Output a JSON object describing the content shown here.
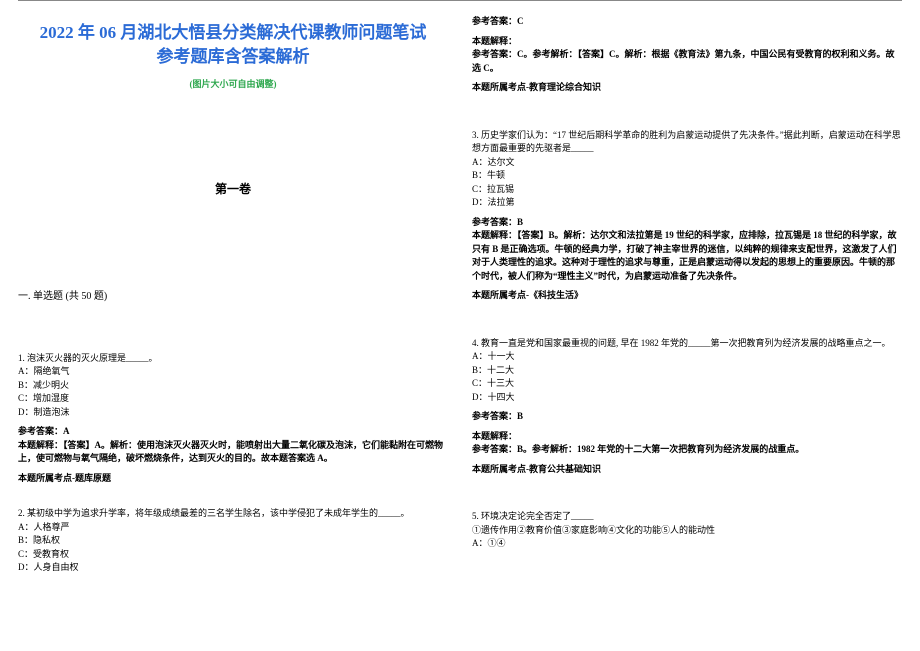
{
  "title_l1": "2022 年 06 月湖北大悟县分类解决代课教师问题笔试",
  "title_l2": "参考题库含答案解析",
  "subtitle": "(图片大小可自由调整)",
  "volume": "第一卷",
  "section1": "一. 单选题 (共 50 题)",
  "q1": {
    "stem": "1. 泡沫灭火器的灭火原理是_____。",
    "A": "A：隔绝氧气",
    "B": "B：减少明火",
    "C": "C：增加湿度",
    "D": "D：制造泡沫",
    "ans_label": "参考答案：A",
    "expl": "本题解释：【答案】A。解析：使用泡沫灭火器灭火时，能喷射出大量二氧化碳及泡沫，它们能黏附在可燃物上，使可燃物与氧气隔绝，破坏燃烧条件，达到灭火的目的。故本题答案选 A。",
    "point": "本题所属考点-题库原题"
  },
  "q2": {
    "stem": "2. 某初级中学为追求升学率，将年级成绩最差的三名学生除名，该中学侵犯了未成年学生的_____。",
    "A": "A：人格尊严",
    "B": "B：隐私权",
    "C": "C：受教育权",
    "D": "D：人身自由权",
    "ans_label": "参考答案：C",
    "expl_label": "本题解释：",
    "expl": "参考答案：C。参考解析：【答案】C。解析：根据《教育法》第九条，中国公民有受教育的权利和义务。故选 C。",
    "point": "本题所属考点-教育理论综合知识"
  },
  "q3": {
    "stem": "3. 历史学家们认为：“17 世纪后期科学革命的胜利为启蒙运动提供了先决条件。”据此判断，启蒙运动在科学思想方面最重要的先驱者是_____",
    "A": "A：达尔文",
    "B": "B：牛顿",
    "C": "C：拉瓦锡",
    "D": "D：法拉第",
    "ans_label": "参考答案：B",
    "expl": "本题解释：【答案】B。解析：达尔文和法拉第是 19 世纪的科学家，应排除，拉瓦锡是 18 世纪的科学家，故只有 B 是正确选项。牛顿的经典力学，打破了神主宰世界的迷信，以纯粹的规律来支配世界，这激发了人们对于人类理性的追求。这种对于理性的追求与尊重，正是启蒙运动得以发起的思想上的重要原因。牛顿的那个时代，被人们称为“理性主义”时代，为启蒙运动准备了先决条件。",
    "point": "本题所属考点-《科技生活》"
  },
  "q4": {
    "stem": "4. 教育一直是党和国家最重视的问题, 早在 1982 年党的_____第一次把教育列为经济发展的战略重点之一。",
    "A": "A：十一大",
    "B": "B：十二大",
    "C": "C：十三大",
    "D": "D：十四大",
    "ans_label": "参考答案：B",
    "expl_label": "本题解释：",
    "expl": "参考答案：B。参考解析：1982 年党的十二大第一次把教育列为经济发展的战重点。",
    "point": "本题所属考点-教育公共基础知识"
  },
  "q5": {
    "stem": "5. 环境决定论完全否定了_____",
    "sub": "①遗传作用②教育价值③家庭影响④文化的功能⑤人的能动性",
    "A": "A：①④"
  }
}
